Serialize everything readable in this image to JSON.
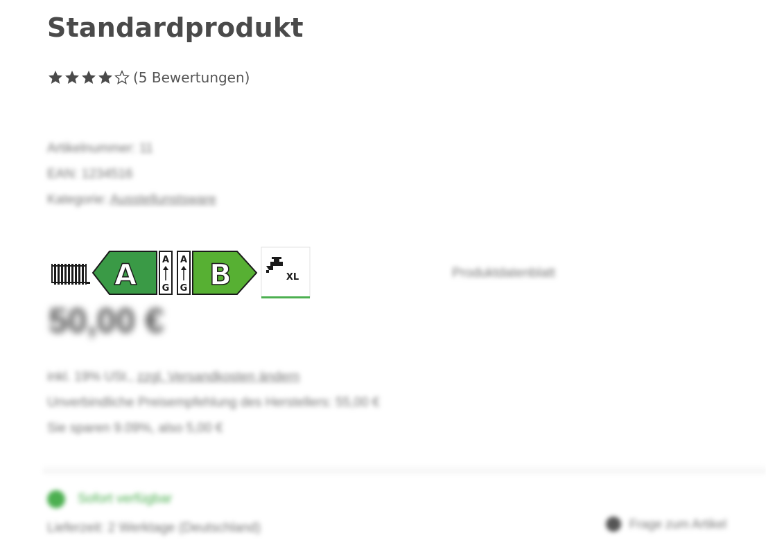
{
  "product": {
    "title": "Standardprodukt",
    "rating": {
      "stars_filled": 4,
      "stars_total": 5,
      "text": "(5 Bewertungen)"
    },
    "meta": {
      "article_number": "Artikelnummer: 11",
      "ean": "EAN: 1234516",
      "category_label": "Kategorie:",
      "category_link": "Ausstellunstsware"
    },
    "energy_labels": {
      "left_class": "A",
      "right_class": "B",
      "scale_top": "A",
      "scale_bottom": "G",
      "tap_size": "XL",
      "colors": {
        "dark_green": "#3a9a46",
        "light_green": "#57b033",
        "outline": "#1a1a1a"
      }
    },
    "info_link": "Produktdatenblatt",
    "price": "50,00 €",
    "tax": {
      "prefix": "inkl. 19% USt.,",
      "shipping_link": "zzgl. Versandkosten ändern",
      "line2": "Unverbindliche Preisempfehlung des Herstellers: 55,00 €",
      "line3": "Sie sparen 9.09%, also 5,00 €"
    },
    "stock": {
      "status": "Sofort verfügbar",
      "status_color": "#4caf50",
      "delivery": "Lieferzeit: 2 Werktage (Deutschland)"
    },
    "question_link": "Frage zum Artikel"
  }
}
